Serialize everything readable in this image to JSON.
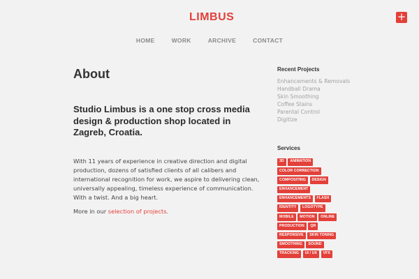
{
  "header": {
    "logo_text": "LIMBUS",
    "plus_label": "+"
  },
  "nav": {
    "items": [
      {
        "label": "HOME"
      },
      {
        "label": "WORK"
      },
      {
        "label": "ARCHIVE"
      },
      {
        "label": "CONTACT"
      }
    ]
  },
  "main": {
    "title": "About",
    "lead": "Studio Limbus is a one stop cross media design & production shop located in Zagreb, Croatia.",
    "body": "With 11 years of experience in creative direction and digital production, dozens of satisfied clients of all calibers and international recognition for work, we aspire to delivering clean, universally appealing, timeless experience of communication. With a twist. And a big heart.",
    "more_prefix": "More in our ",
    "more_link": "selection of projects",
    "more_suffix": "."
  },
  "sidebar": {
    "recent_heading": "Recent Projects",
    "recent_items": [
      "Enhancements & Removals",
      "Handball Drama",
      "Skin Smoothing",
      "Coffee Stains",
      "Parental Control",
      "Digitize"
    ],
    "services_heading": "Services",
    "services_tags": [
      "3D",
      "ANIMATION",
      "COLOR CORRECTION",
      "COMPOSITING",
      "DESIGN",
      "ENHANCEMENT",
      "ENHANCEMENTS",
      "FLASH",
      "IDENTITY",
      "LOGOTYPE",
      "MOBILE",
      "MOTION",
      "ONLINE",
      "PRODUCTION",
      "QR",
      "RESPONSIVE",
      "SKIN TONING",
      "SMOOTHING",
      "SOUND",
      "TRACKING",
      "UI / UX",
      "VFX"
    ]
  },
  "colors": {
    "accent": "#e3403a",
    "background": "#f3f2f2"
  }
}
